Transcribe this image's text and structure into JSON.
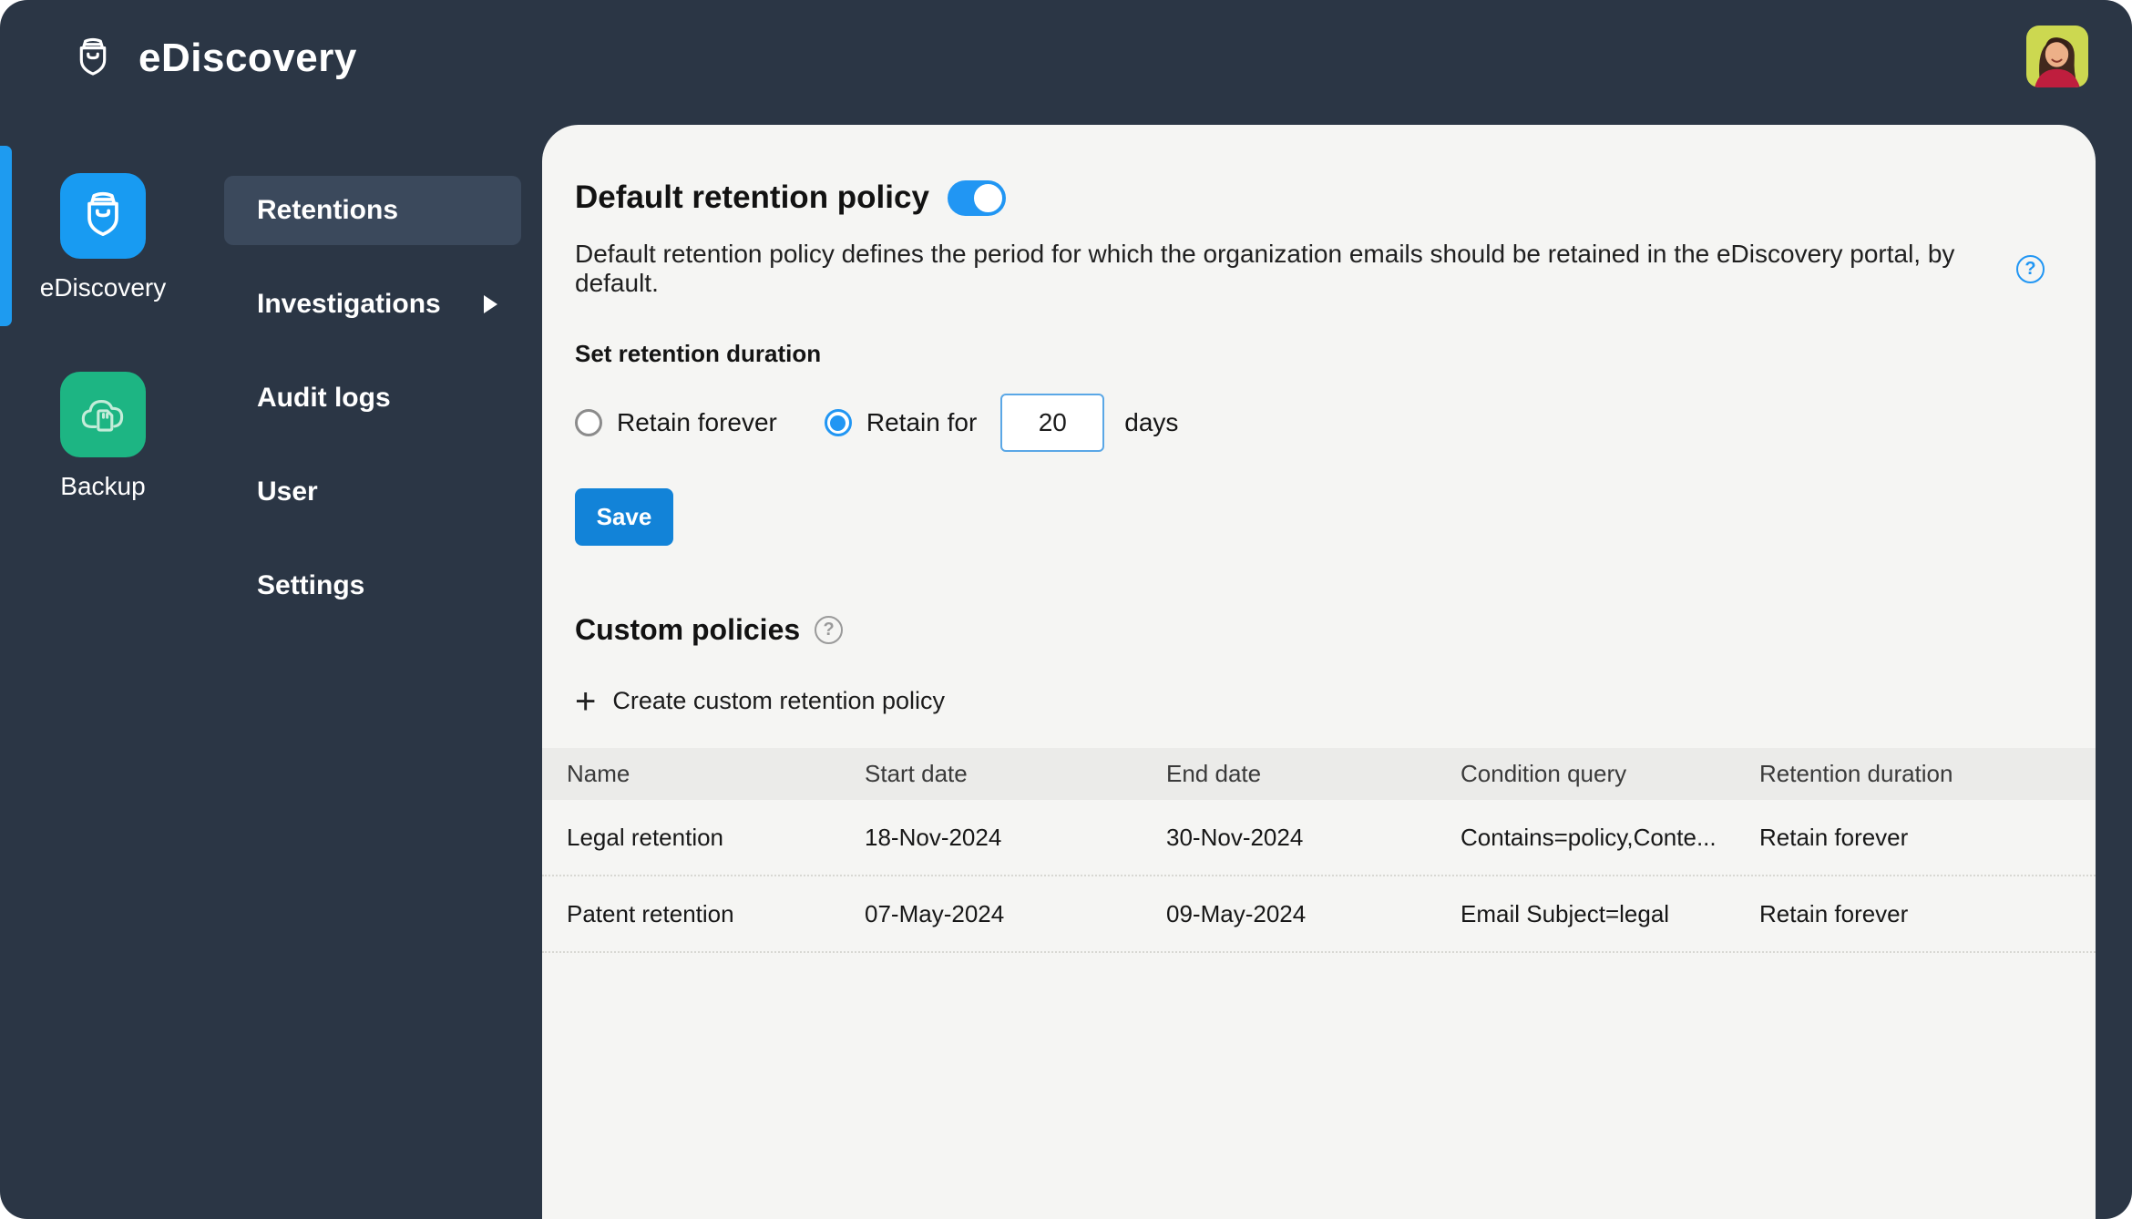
{
  "app": {
    "title": "eDiscovery"
  },
  "colors": {
    "background_dark": "#2b3645",
    "accent_blue": "#2196f3",
    "tile_blue": "#189bf2",
    "tile_green": "#1db583",
    "save_blue": "#1283d8",
    "card_bg": "#f5f5f3",
    "active_pill": "#3b495c"
  },
  "header": {
    "logo_icon": "shield-vault-icon",
    "avatar": "user-avatar-photo"
  },
  "sidebar": {
    "apps": [
      {
        "label": "eDiscovery",
        "icon": "shield-vault-icon",
        "active": true
      },
      {
        "label": "Backup",
        "icon": "cloud-sdcard-icon",
        "active": false
      }
    ],
    "menu": [
      {
        "label": "Retentions",
        "active": true
      },
      {
        "label": "Investigations",
        "has_submenu": true
      },
      {
        "label": "Audit logs"
      },
      {
        "label": "User"
      },
      {
        "label": "Settings"
      }
    ]
  },
  "main": {
    "default_policy": {
      "title": "Default retention policy",
      "enabled": true,
      "description": "Default retention policy defines the period for which the organization emails should be retained in the eDiscovery portal, by default.",
      "help_icon": "question-circle-icon",
      "duration_label": "Set retention duration",
      "options": [
        {
          "label": "Retain forever",
          "selected": false
        },
        {
          "label": "Retain for",
          "selected": true
        }
      ],
      "days_value": "20",
      "days_suffix": "days",
      "save_label": "Save"
    },
    "custom_policies": {
      "title": "Custom policies",
      "help_icon": "question-circle-icon",
      "create_label": "Create custom retention policy",
      "table": {
        "columns": [
          "Name",
          "Start date",
          "End date",
          "Condition query",
          "Retention duration"
        ],
        "rows": [
          [
            "Legal retention",
            "18-Nov-2024",
            "30-Nov-2024",
            "Contains=policy,Conte...",
            "Retain forever"
          ],
          [
            "Patent retention",
            "07-May-2024",
            "09-May-2024",
            "Email Subject=legal",
            "Retain forever"
          ]
        ]
      }
    }
  }
}
